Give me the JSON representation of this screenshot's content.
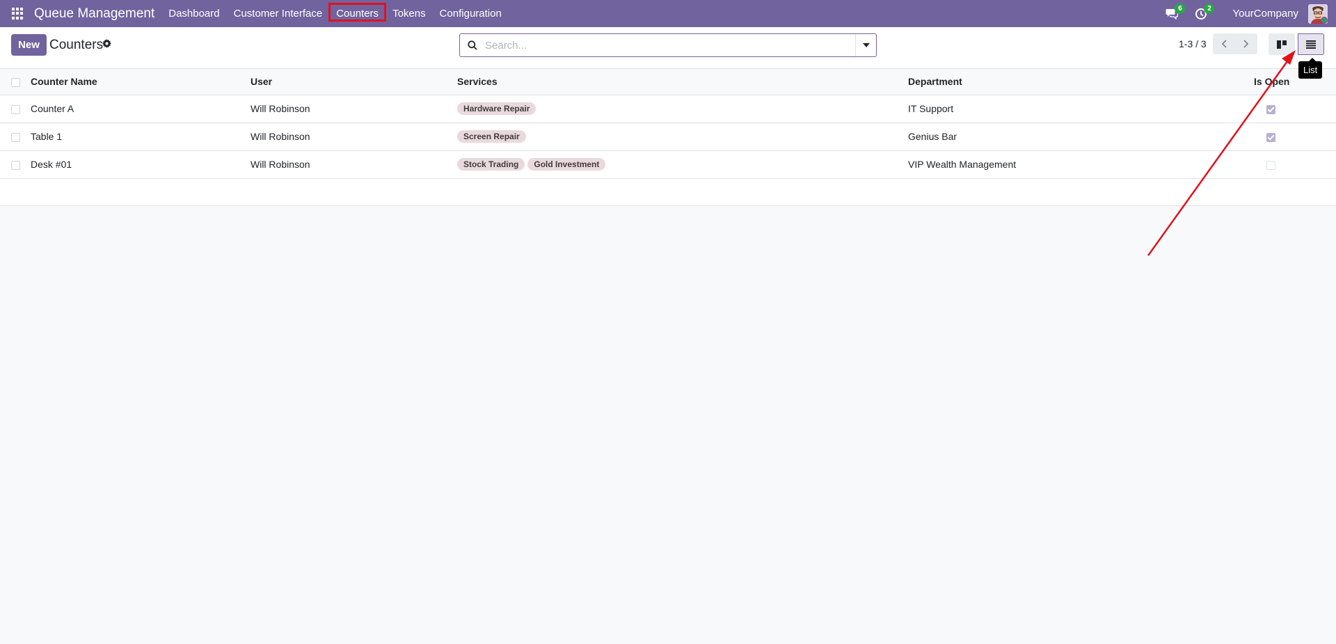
{
  "navbar": {
    "brand": "Queue Management",
    "menu": [
      {
        "label": "Dashboard"
      },
      {
        "label": "Customer Interface"
      },
      {
        "label": "Counters"
      },
      {
        "label": "Tokens"
      },
      {
        "label": "Configuration"
      }
    ],
    "messages_badge": "6",
    "activities_badge": "2",
    "company": "YourCompany"
  },
  "control": {
    "new_label": "New",
    "title": "Counters",
    "search_placeholder": "Search...",
    "pager": "1-3 / 3",
    "tooltip": "List"
  },
  "table": {
    "headers": [
      "Counter Name",
      "User",
      "Services",
      "Department",
      "Is Open"
    ],
    "rows": [
      {
        "name": "Counter A",
        "user": "Will Robinson",
        "services": [
          "Hardware Repair"
        ],
        "department": "IT Support",
        "is_open": true
      },
      {
        "name": "Table 1",
        "user": "Will Robinson",
        "services": [
          "Screen Repair"
        ],
        "department": "Genius Bar",
        "is_open": true
      },
      {
        "name": "Desk #01",
        "user": "Will Robinson",
        "services": [
          "Stock Trading",
          "Gold Investment"
        ],
        "department": "VIP Wealth Management",
        "is_open": false
      }
    ]
  },
  "colors": {
    "primary": "#71639e",
    "annotation": "#e0131d",
    "badge": "#28a745"
  }
}
